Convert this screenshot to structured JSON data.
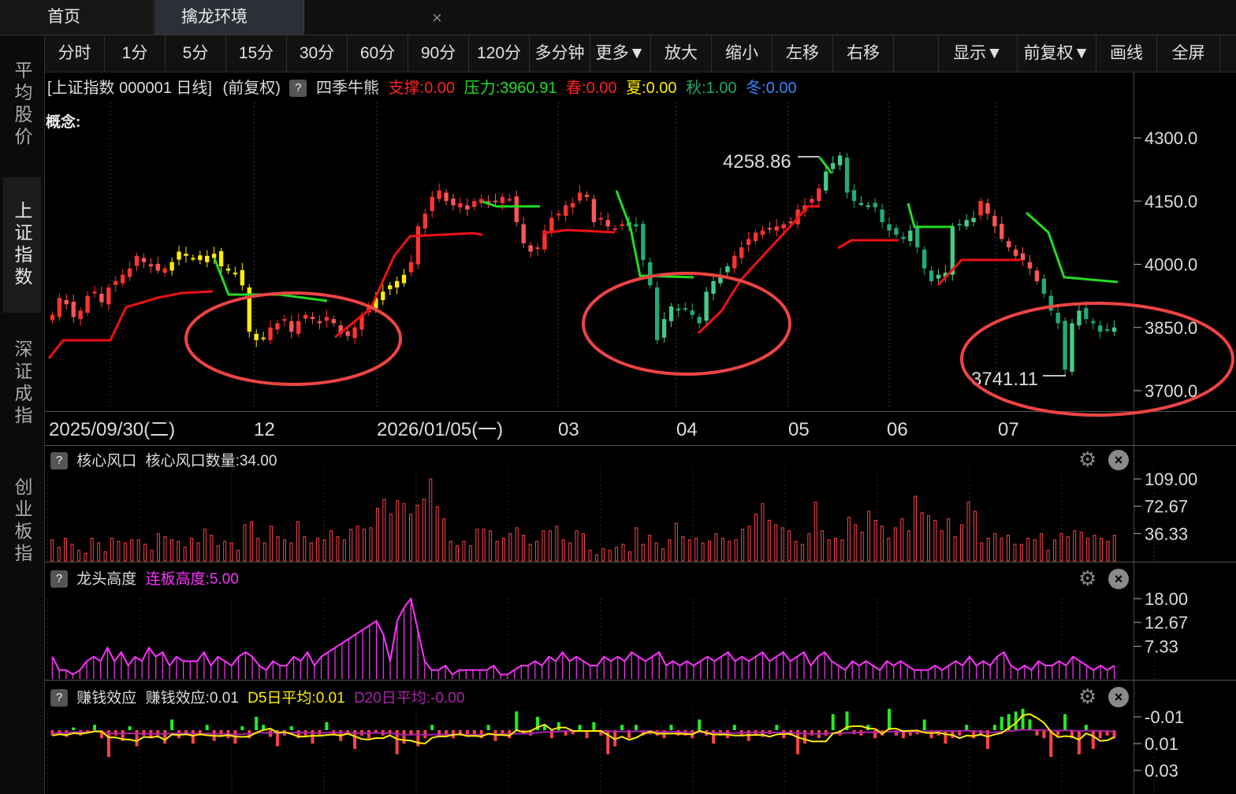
{
  "tabs": [
    {
      "label": "首页"
    },
    {
      "label": "擒龙环境"
    }
  ],
  "tab_close": "×",
  "sidebar": {
    "items": [
      {
        "label": "平均股价"
      },
      {
        "label": "上证指数"
      },
      {
        "label": "深证成指"
      },
      {
        "label": "创业板指"
      }
    ]
  },
  "toolbar": {
    "items": [
      "分时",
      "1分",
      "5分",
      "15分",
      "30分",
      "60分",
      "90分",
      "120分",
      "多分钟",
      "更多▼",
      "放大",
      "缩小",
      "左移",
      "右移",
      "",
      "显示▼",
      "前复权▼",
      "画线",
      "全屏"
    ]
  },
  "chart_header": {
    "title": "[上证指数 000001 日线]",
    "adjust": "(前复权)",
    "help": "?",
    "indicator": "四季牛熊",
    "support": "支撑:0.00",
    "pressure": "压力:3960.91",
    "spring": "春:0.00",
    "summer": "夏:0.00",
    "autumn": "秋:1.00",
    "winter": "冬:0.00"
  },
  "concept_label": "概念:",
  "annotations": {
    "high": "4258.86",
    "low": "3741.11"
  },
  "colors": {
    "up": "#ff3333",
    "down": "#22cccc",
    "yellow": "#ffee00",
    "green_line": "#22dd22",
    "red_line": "#ee1111",
    "magenta": "#ff33ff",
    "bg": "#000000",
    "circle": "#ee4444",
    "bar_red": "#ff4444",
    "bar_green": "#22ee22"
  },
  "chart_data": [
    {
      "type": "candlestick",
      "title": "[上证指数 000001 日线]",
      "y_ticks": [
        "4300.0",
        "4150.0",
        "4000.0",
        "3850.0",
        "3700.0"
      ],
      "ylim": [
        3690,
        4310
      ],
      "x_ticks": [
        "2025/09/30(二)",
        "12",
        "2026/01/05(一)",
        "03",
        "04",
        "05",
        "06",
        "07"
      ],
      "close": [
        3880,
        3920,
        3905,
        3875,
        3890,
        3925,
        3935,
        3910,
        3945,
        3960,
        3975,
        3990,
        4020,
        4005,
        3995,
        3985,
        3990,
        4005,
        4030,
        4020,
        4015,
        4010,
        4020,
        4025,
        3995,
        3985,
        3980,
        3950,
        3840,
        3820,
        3825,
        3850,
        3860,
        3870,
        3840,
        3865,
        3880,
        3870,
        3860,
        3875,
        3860,
        3835,
        3830,
        3850,
        3880,
        3900,
        3920,
        3935,
        3950,
        3960,
        3975,
        4005,
        4090,
        4120,
        4160,
        4175,
        4150,
        4140,
        4145,
        4130,
        4150,
        4155,
        4145,
        4150,
        4160,
        4155,
        4100,
        4050,
        4030,
        4040,
        4080,
        4110,
        4120,
        4140,
        4145,
        4170,
        4160,
        4100,
        4110,
        4090,
        4085,
        4095,
        4100,
        4090,
        4010,
        3950,
        3820,
        3870,
        3900,
        3890,
        3895,
        3880,
        3860,
        3935,
        3960,
        3975,
        3995,
        4020,
        4040,
        4060,
        4075,
        4080,
        4085,
        4090,
        4095,
        4100,
        4130,
        4140,
        4155,
        4180,
        4220,
        4240,
        4258,
        4170,
        4150,
        4145,
        4140,
        4135,
        4100,
        4080,
        4070,
        4060,
        4080,
        4040,
        3990,
        3960,
        3975,
        3980,
        4090,
        4095,
        4105,
        4110,
        4150,
        4120,
        4090,
        4060,
        4040,
        4020,
        4010,
        3990,
        3960,
        3930,
        3890,
        3860,
        3750,
        3860,
        3890,
        3870,
        3860,
        3840,
        3845,
        3850
      ]
    },
    {
      "type": "bar",
      "title": "核心风口",
      "label": "核心风口数量:34.00",
      "y_ticks": [
        "109.00",
        "72.67",
        "36.33"
      ],
      "ylim": [
        0,
        109
      ],
      "values": [
        28,
        18,
        30,
        22,
        14,
        10,
        30,
        24,
        12,
        30,
        26,
        24,
        28,
        28,
        22,
        14,
        36,
        32,
        28,
        26,
        18,
        30,
        24,
        42,
        34,
        20,
        26,
        24,
        14,
        48,
        52,
        30,
        24,
        46,
        32,
        28,
        24,
        52,
        32,
        24,
        30,
        28,
        40,
        32,
        28,
        42,
        46,
        42,
        44,
        70,
        82,
        62,
        80,
        76,
        62,
        74,
        82,
        109,
        72,
        56,
        26,
        20,
        26,
        20,
        42,
        42,
        40,
        26,
        30,
        36,
        44,
        34,
        22,
        26,
        40,
        40,
        46,
        28,
        24,
        40,
        36,
        14,
        8,
        16,
        14,
        18,
        22,
        12,
        44,
        22,
        34,
        24,
        16,
        28,
        50,
        32,
        28,
        30,
        24,
        26,
        36,
        30,
        26,
        28,
        42,
        46,
        62,
        76,
        54,
        48,
        44,
        40,
        26,
        22,
        36,
        78,
        40,
        28,
        30,
        28,
        58,
        48,
        38,
        66,
        54,
        46,
        30,
        44,
        56,
        40,
        86,
        64,
        60,
        54,
        40,
        56,
        32,
        48,
        78,
        66,
        24,
        30,
        36,
        30,
        34,
        22,
        22,
        30,
        28,
        36,
        14,
        28,
        36,
        32,
        40,
        38,
        30,
        34,
        30,
        26,
        34
      ]
    },
    {
      "type": "area",
      "title": "龙头高度",
      "label": "连板高度:5.00",
      "y_ticks": [
        "18.00",
        "12.67",
        "7.33"
      ],
      "ylim": [
        0,
        18
      ],
      "values": [
        5,
        2,
        2,
        1,
        2,
        4,
        5,
        4,
        7,
        4,
        6,
        3,
        5,
        4,
        7,
        5,
        6,
        3,
        5,
        4,
        4,
        4,
        6,
        3,
        5,
        4,
        3,
        5,
        6,
        5,
        3,
        2,
        4,
        3,
        3,
        5,
        4,
        6,
        3,
        5,
        6,
        7,
        8,
        9,
        10,
        11,
        12,
        13,
        10,
        4,
        13,
        16,
        18,
        11,
        4,
        2,
        2,
        3,
        1,
        2,
        2,
        2,
        2,
        2,
        3,
        1,
        1,
        2,
        3,
        3,
        4,
        3,
        5,
        4,
        6,
        4,
        5,
        4,
        3,
        3,
        5,
        4,
        5,
        4,
        6,
        5,
        4,
        5,
        6,
        3,
        4,
        3,
        4,
        3,
        4,
        5,
        4,
        5,
        6,
        4,
        5,
        4,
        5,
        6,
        4,
        5,
        6,
        4,
        5,
        6,
        3,
        5,
        6,
        4,
        3,
        2,
        4,
        3,
        4,
        3,
        2,
        4,
        3,
        4,
        3,
        2,
        2,
        2,
        3,
        2,
        3,
        4,
        3,
        5,
        3,
        4,
        3,
        5,
        6,
        3,
        2,
        3,
        2,
        4,
        3,
        3,
        4,
        3,
        5,
        4,
        3,
        2,
        3,
        2,
        3
      ]
    },
    {
      "type": "bar",
      "title": "赚钱效应",
      "label": "赚钱效应:0.01",
      "series_labels": [
        "D5日平均:0.01",
        "D20日平均:-0.00"
      ],
      "y_ticks": [
        "0.03",
        "0.01",
        "-0.01"
      ],
      "ylim": [
        -0.018,
        0.035
      ],
      "values": [
        0.004,
        0.002,
        0.005,
        -0.002,
        0.004,
        0.001,
        -0.004,
        0.006,
        0.02,
        0.004,
        0.008,
        -0.003,
        0.012,
        0.004,
        0.006,
        0.004,
        0.01,
        -0.008,
        0.006,
        0.003,
        0.01,
        0.004,
        -0.004,
        0.008,
        0.004,
        0.006,
        0.01,
        -0.003,
        0.006,
        -0.01,
        -0.004,
        0.005,
        0.012,
        0.004,
        -0.003,
        0.006,
        0.004,
        0.01,
        0.004,
        -0.006,
        0.004,
        0.008,
        0.003,
        0.014,
        0.004,
        0.006,
        0.002,
        0.004,
        0.003,
        0.018,
        0.01,
        0.004,
        0.012,
        0.006,
        -0.004,
        0.005,
        0.004,
        0.006,
        0.004,
        0.003,
        0.004,
        0.006,
        -0.004,
        0.008,
        0.004,
        0.006,
        -0.014,
        0.003,
        0.004,
        -0.01,
        -0.004,
        0.006,
        -0.006,
        0.004,
        0.003,
        -0.004,
        0.006,
        -0.006,
        0.004,
        0.018,
        0.012,
        -0.004,
        0.006,
        -0.004,
        0.004,
        0.003,
        0.004,
        0.006,
        -0.004,
        0.004,
        0.004,
        0.006,
        -0.008,
        0.004,
        0.01,
        0.004,
        0.006,
        -0.004,
        0.004,
        0.008,
        0.004,
        0.005,
        0.003,
        -0.004,
        0.006,
        0.004,
        0.018,
        0.01,
        0.004,
        0.006,
        0.004,
        -0.012,
        0.004,
        -0.014,
        0.003,
        0.004,
        -0.004,
        0.006,
        0.004,
        -0.016,
        0.004,
        0.006,
        0.004,
        0.003,
        -0.008,
        0.006,
        0.004,
        0.01,
        0.006,
        0.004,
        -0.004,
        0.006,
        0.004,
        0.014,
        -0.004,
        -0.01,
        -0.012,
        -0.014,
        -0.016,
        -0.008,
        0.004,
        0.006,
        0.02,
        0.004,
        -0.012,
        0.006,
        0.018,
        -0.004,
        0.014,
        0.006,
        0.004,
        0.006
      ]
    }
  ]
}
